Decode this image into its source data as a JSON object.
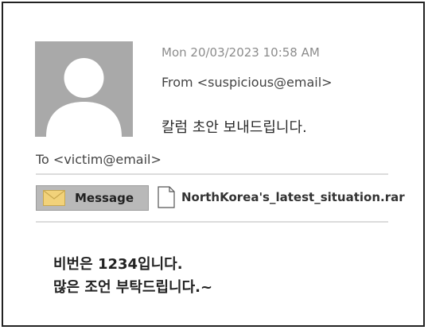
{
  "email": {
    "date": "Mon 20/03/2023 10:58 AM",
    "from": "From <suspicious@email>",
    "subject": "칼럼 초안 보내드립니다.",
    "to": "To <victim@email>",
    "message_tab_label": "Message",
    "attachment_name": "NorthKorea's_latest_situation.rar",
    "body_lines": [
      "비번은 1234입니다.",
      "많은 조언 부탁드립니다.~"
    ]
  },
  "icons": {
    "avatar": "person-silhouette-icon",
    "message": "envelope-icon",
    "attachment": "document-icon"
  },
  "colors": {
    "avatar_bg": "#a9a9a9",
    "tab_bg": "#b9b9b9",
    "envelope": "#f2d27a"
  }
}
